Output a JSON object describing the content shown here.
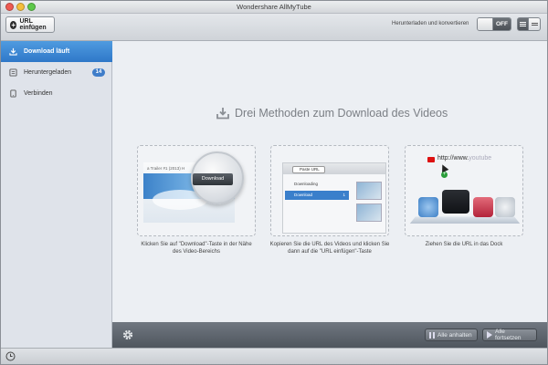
{
  "window": {
    "title": "Wondershare AllMyTube"
  },
  "toolbar": {
    "url_button_label": "URL einfügen",
    "convert_label": "Herunterladen und konvertieren",
    "toggle_label": "OFF"
  },
  "sidebar": {
    "items": [
      {
        "label": "Download läuft",
        "icon": "download-icon",
        "active": true
      },
      {
        "label": "Heruntergeladen",
        "icon": "downloaded-icon",
        "badge": "14"
      },
      {
        "label": "Verbinden",
        "icon": "connect-icon"
      }
    ]
  },
  "main": {
    "heading": "Drei Methoden zum Download des Videos",
    "cards": [
      {
        "caption": "Klicken Sie auf \"Download\"-Taste in der Nähe des Video-Bereichs",
        "illustration": {
          "title": "a Trailer #1 (2013) H",
          "button": "Download"
        }
      },
      {
        "caption": "Kopieren Sie die URL des Videos und klicken Sie dann auf die \"URL einfügen\"-Taste",
        "illustration": {
          "paste": "Paste URL",
          "row1": "Downloading",
          "row2": "Download",
          "badge": "1"
        }
      },
      {
        "caption": "Ziehen Sie die URL in das Dock",
        "illustration": {
          "url_prefix": "http://www.",
          "url_suffix": "youtube"
        }
      }
    ]
  },
  "bottombar": {
    "pause_label": "Alle anhalten",
    "resume_label": "Alle fortsetzen"
  },
  "colors": {
    "accent": "#2f78c8",
    "badge": "#3f7dc9",
    "bottombar": "#5c636b"
  }
}
